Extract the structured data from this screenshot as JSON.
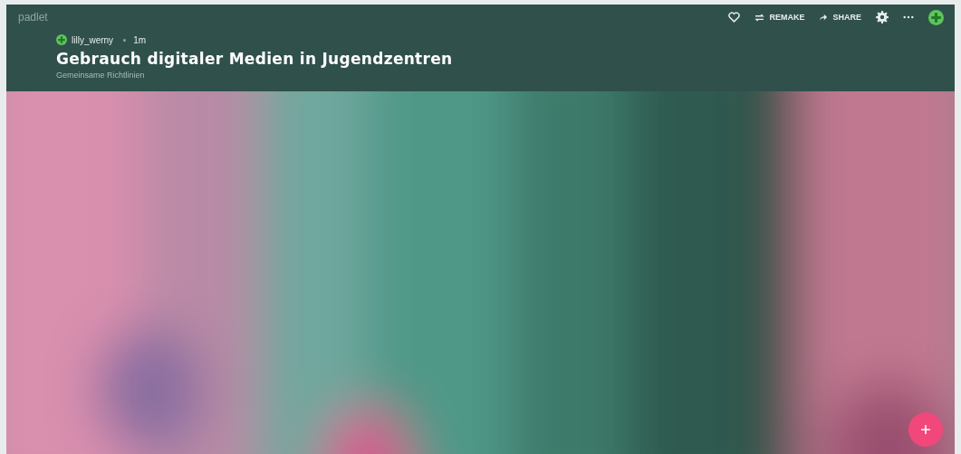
{
  "brand": "padlet",
  "toolbar": [
    {
      "kind": "heart"
    },
    {
      "kind": "remake",
      "label": "REMAKE"
    },
    {
      "kind": "share",
      "label": "SHARE"
    },
    {
      "kind": "gear"
    },
    {
      "kind": "more"
    },
    {
      "kind": "avatar"
    }
  ],
  "author": {
    "name": "lilly_werny",
    "time": "1m"
  },
  "title": "Gebrauch digitaler Medien in Jugendzentren",
  "subtitle": "Gemeinsame Richtlinien"
}
